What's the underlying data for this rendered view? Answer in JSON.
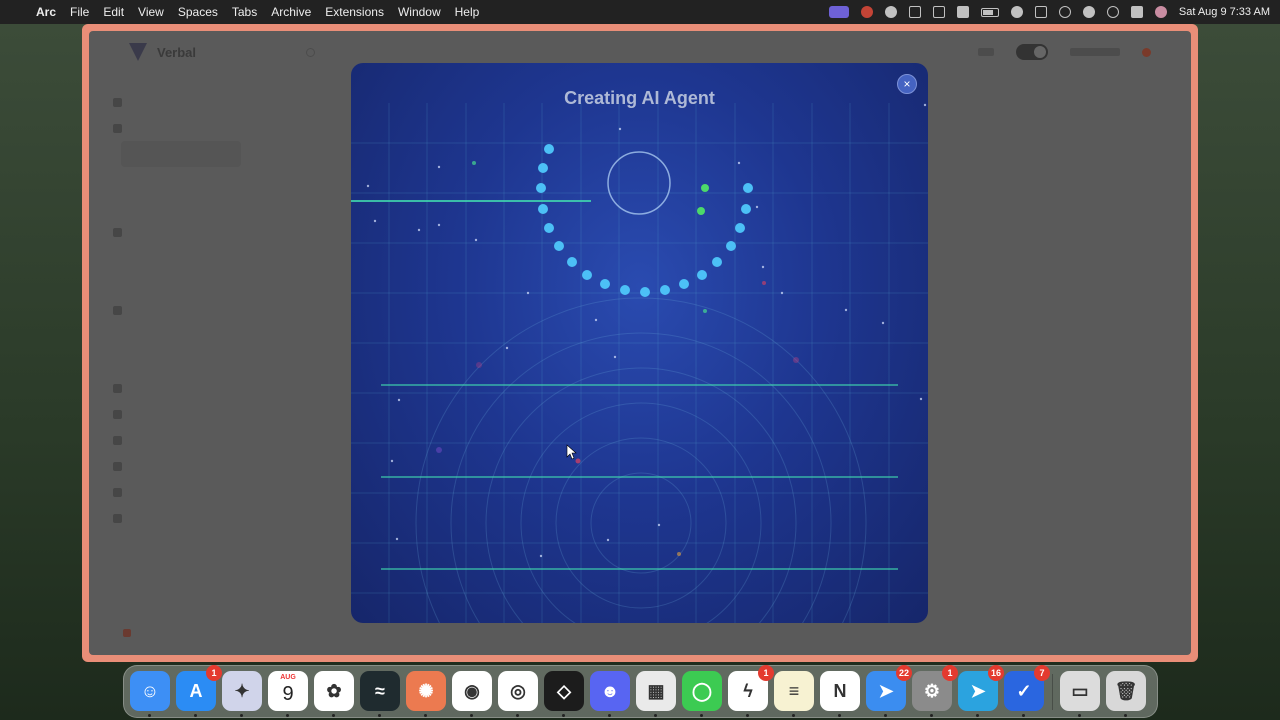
{
  "menubar": {
    "app_name": "Arc",
    "menus": [
      "File",
      "Edit",
      "View",
      "Spaces",
      "Tabs",
      "Archive",
      "Extensions",
      "Window",
      "Help"
    ],
    "clock": "Sat Aug 9  7:33 AM"
  },
  "app": {
    "brand": "Verbal"
  },
  "modal": {
    "title": "Creating AI Agent",
    "close_label": "×"
  },
  "dock": {
    "items": [
      {
        "name": "finder-icon",
        "color": "#3d8ff5",
        "glyph": "☺"
      },
      {
        "name": "app-store-icon",
        "color": "#2b8cf4",
        "glyph": "A",
        "badge": "1"
      },
      {
        "name": "affinity-icon",
        "color": "#d0d4ea",
        "glyph": "✦"
      },
      {
        "name": "calendar-icon",
        "color": "#ffffff",
        "month": "AUG",
        "day": "9"
      },
      {
        "name": "chatgpt-icon",
        "color": "#ffffff",
        "glyph": "✿"
      },
      {
        "name": "arc-icon",
        "color": "#1f2b2f",
        "glyph": "≈"
      },
      {
        "name": "claude-icon",
        "color": "#ec7a50",
        "glyph": "✺"
      },
      {
        "name": "chrome-icon",
        "color": "#ffffff",
        "glyph": "◉"
      },
      {
        "name": "chrome-canary-icon",
        "color": "#ffffff",
        "glyph": "◎"
      },
      {
        "name": "cube-app-icon",
        "color": "#1c1c1c",
        "glyph": "◇"
      },
      {
        "name": "discord-icon",
        "color": "#5865f2",
        "glyph": "☻"
      },
      {
        "name": "launchpad-icon",
        "color": "#eaeaea",
        "glyph": "▦"
      },
      {
        "name": "messages-icon",
        "color": "#3ccb52",
        "glyph": "◯"
      },
      {
        "name": "messenger-icon",
        "color": "#ffffff",
        "glyph": "ϟ",
        "badge": "1"
      },
      {
        "name": "notes-icon",
        "color": "#f7f2d2",
        "glyph": "≡"
      },
      {
        "name": "notion-icon",
        "color": "#ffffff",
        "glyph": "N"
      },
      {
        "name": "spark-icon",
        "color": "#3b8df0",
        "glyph": "➤",
        "badge": "22"
      },
      {
        "name": "system-settings-icon",
        "color": "#8b8b8b",
        "glyph": "⚙",
        "badge": "1"
      },
      {
        "name": "telegram-icon",
        "color": "#2ba3df",
        "glyph": "➤",
        "badge": "16"
      },
      {
        "name": "tasks-icon",
        "color": "#2a66e0",
        "glyph": "✓",
        "badge": "7"
      },
      {
        "name": "downloads-stack-icon",
        "color": "#dcdcdc",
        "glyph": "▭"
      },
      {
        "name": "trash-icon",
        "color": "#d8d8d8",
        "glyph": "🗑"
      }
    ]
  }
}
